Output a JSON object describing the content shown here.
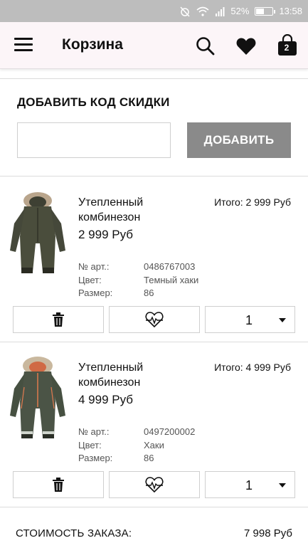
{
  "status_bar": {
    "battery_percent": "52%",
    "battery_level": 0.52,
    "time": "13:58",
    "icons": [
      "alarm-off-icon",
      "wifi-icon",
      "signal-icon",
      "battery-icon"
    ]
  },
  "app_bar": {
    "title": "Корзина",
    "bag_count": "2",
    "icons": [
      "menu-icon",
      "search-icon",
      "heart-icon",
      "shopping-bag-icon"
    ]
  },
  "discount": {
    "title": "ДОБАВИТЬ КОД СКИДКИ",
    "input_value": "",
    "button_label": "ДОБАВИТЬ"
  },
  "items": [
    {
      "name": "Утепленный комбинезон",
      "price": "2 999 Руб",
      "total": "Итого: 2 999 Руб",
      "article_label": "№ арт.:",
      "article": "0486767003",
      "color_label": "Цвет:",
      "color": "Темный хаки",
      "size_label": "Размер:",
      "size": "86",
      "quantity": "1"
    },
    {
      "name": "Утепленный комбинезон",
      "price": "4 999 Руб",
      "total": "Итого: 4 999 Руб",
      "article_label": "№ арт.:",
      "article": "0497200002",
      "color_label": "Цвет:",
      "color": "Хаки",
      "size_label": "Размер:",
      "size": "86",
      "quantity": "1"
    }
  ],
  "order": {
    "total_label": "СТОИМОСТЬ ЗАКАЗА:",
    "total_value": "7 998 Руб"
  },
  "colors": {
    "status_bar": "#bdbdbd",
    "app_bar": "#fcf5f8",
    "add_button": "#8a8a8a",
    "product_khaki": "#4a4d3c"
  }
}
